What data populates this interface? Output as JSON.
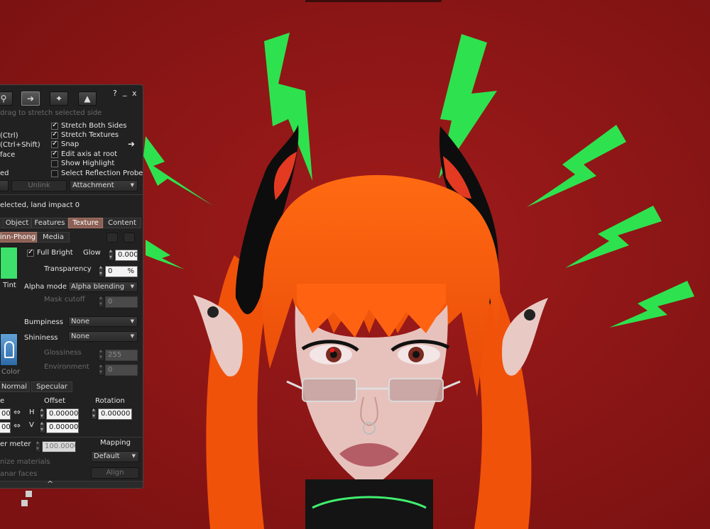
{
  "colors": {
    "background": "#8e1717",
    "hair": "#ff5a0a",
    "bolts": "#2ee24f",
    "panel": "#212121",
    "tab_active": "#8c6055",
    "cursor": "#a25bd8",
    "tint_swatch": "#3de06a"
  },
  "toolbar": {
    "icons": [
      "focus-icon",
      "move-icon",
      "wand-icon",
      "bulldozer-icon"
    ],
    "help": "?",
    "minimize": "_",
    "close": "x"
  },
  "hint": "drag to stretch selected side",
  "left_options": [
    "(Ctrl)",
    "(Ctrl+Shift)",
    "face",
    "ed"
  ],
  "checkboxes": [
    {
      "label": "Stretch Both Sides",
      "checked": true
    },
    {
      "label": "Stretch Textures",
      "checked": true
    },
    {
      "label": "Snap",
      "checked": true
    },
    {
      "label": "Edit axis at root",
      "checked": true
    },
    {
      "label": "Show Highlight",
      "checked": false
    },
    {
      "label": "Select Reflection Probes",
      "checked": false
    }
  ],
  "link_row": {
    "unlink": "Unlink",
    "attachment": "Attachment"
  },
  "status": "elected, land impact 0",
  "tabs": [
    {
      "label": "Object",
      "active": false
    },
    {
      "label": "Features",
      "active": false
    },
    {
      "label": "Texture",
      "active": true
    },
    {
      "label": "Content",
      "active": false
    }
  ],
  "subtabs": {
    "shader": "inn-Phong",
    "media": "Media"
  },
  "tint_label": "Tint",
  "full_bright": {
    "label": "Full Bright",
    "checked": true
  },
  "glow": {
    "label": "Glow",
    "value": "0.000"
  },
  "transparency": {
    "label": "Transparency",
    "value": "0",
    "unit": "%"
  },
  "alpha_mode": {
    "label": "Alpha mode",
    "value": "Alpha blending"
  },
  "mask_cutoff": {
    "label": "Mask cutoff",
    "value": "0"
  },
  "bumpiness": {
    "label": "Bumpiness",
    "value": "None"
  },
  "shininess": {
    "label": "Shininess",
    "value": "None"
  },
  "glossiness": {
    "label": "Glossiness",
    "value": "255"
  },
  "environment": {
    "label": "Environment",
    "value": "0"
  },
  "color_label": "Color",
  "map_tabs": {
    "normal": "Normal",
    "specular": "Specular"
  },
  "offset": {
    "scale_heading": "e",
    "heading": "Offset",
    "h_label": "H",
    "v_label": "V",
    "h": "0.00000",
    "v": "0.00000",
    "scale_h": "00",
    "scale_v": "00"
  },
  "rotation": {
    "heading": "Rotation",
    "value": "0.00000"
  },
  "repeats": {
    "label": "er meter",
    "value": "100.00000"
  },
  "mapping": {
    "heading": "Mapping",
    "value": "Default"
  },
  "sync_materials": "nize materials",
  "planar_faces": "anar faces",
  "align_button": "Align",
  "expand_glyph": "^"
}
